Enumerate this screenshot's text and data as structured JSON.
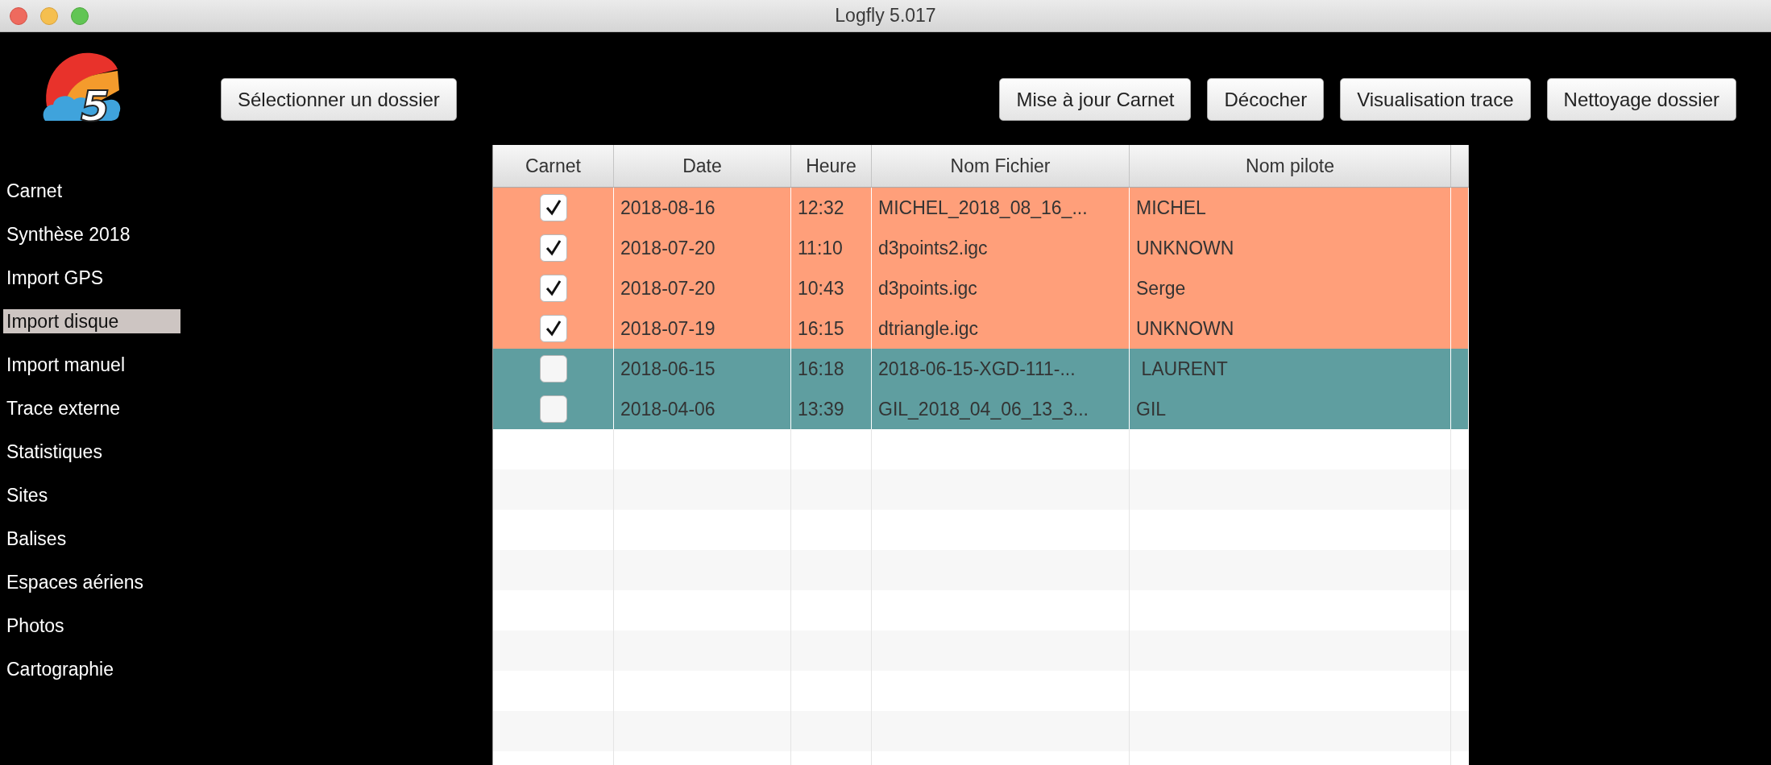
{
  "window": {
    "title": "Logfly 5.017"
  },
  "logo": {
    "text": "5"
  },
  "toolbar": {
    "left_buttons": [
      "Sélectionner un dossier"
    ],
    "right_buttons": [
      "Mise à jour Carnet",
      "Décocher",
      "Visualisation trace",
      "Nettoyage dossier"
    ]
  },
  "sidebar": {
    "items": [
      {
        "label": "Carnet",
        "selected": false
      },
      {
        "label": "Synthèse 2018",
        "selected": false
      },
      {
        "label": "Import GPS",
        "selected": false
      },
      {
        "label": "Import disque",
        "selected": true
      },
      {
        "label": "Import manuel",
        "selected": false
      },
      {
        "label": "Trace externe",
        "selected": false
      },
      {
        "label": "Statistiques",
        "selected": false
      },
      {
        "label": "Sites",
        "selected": false
      },
      {
        "label": "Balises",
        "selected": false
      },
      {
        "label": "Espaces aériens",
        "selected": false
      },
      {
        "label": "Photos",
        "selected": false
      },
      {
        "label": "Cartographie",
        "selected": false
      }
    ]
  },
  "table": {
    "columns": [
      "Carnet",
      "Date",
      "Heure",
      "Nom Fichier",
      "Nom pilote"
    ],
    "rows": [
      {
        "checked": true,
        "color": "#ff9f7a",
        "date": "2018-08-16",
        "time": "12:32",
        "file": "MICHEL_2018_08_16_...",
        "pilot": "MICHEL"
      },
      {
        "checked": true,
        "color": "#ff9f7a",
        "date": "2018-07-20",
        "time": "11:10",
        "file": "d3points2.igc",
        "pilot": "UNKNOWN"
      },
      {
        "checked": true,
        "color": "#ff9f7a",
        "date": "2018-07-20",
        "time": "10:43",
        "file": "d3points.igc",
        "pilot": "Serge"
      },
      {
        "checked": true,
        "color": "#ff9f7a",
        "date": "2018-07-19",
        "time": "16:15",
        "file": "dtriangle.igc",
        "pilot": "UNKNOWN"
      },
      {
        "checked": false,
        "color": "#5f9ea0",
        "date": "2018-06-15",
        "time": "16:18",
        "file": "2018-06-15-XGD-111-...",
        "pilot": " LAURENT"
      },
      {
        "checked": false,
        "color": "#5f9ea0",
        "date": "2018-04-06",
        "time": "13:39",
        "file": "GIL_2018_04_06_13_3...",
        "pilot": "GIL"
      }
    ]
  }
}
